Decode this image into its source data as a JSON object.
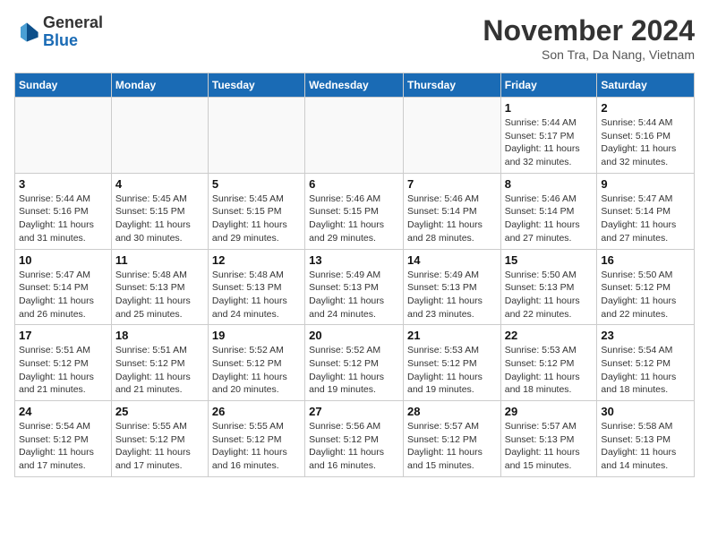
{
  "header": {
    "logo_general": "General",
    "logo_blue": "Blue",
    "month_year": "November 2024",
    "location": "Son Tra, Da Nang, Vietnam"
  },
  "days_of_week": [
    "Sunday",
    "Monday",
    "Tuesday",
    "Wednesday",
    "Thursday",
    "Friday",
    "Saturday"
  ],
  "weeks": [
    [
      {
        "day": "",
        "info": ""
      },
      {
        "day": "",
        "info": ""
      },
      {
        "day": "",
        "info": ""
      },
      {
        "day": "",
        "info": ""
      },
      {
        "day": "",
        "info": ""
      },
      {
        "day": "1",
        "info": "Sunrise: 5:44 AM\nSunset: 5:17 PM\nDaylight: 11 hours\nand 32 minutes."
      },
      {
        "day": "2",
        "info": "Sunrise: 5:44 AM\nSunset: 5:16 PM\nDaylight: 11 hours\nand 32 minutes."
      }
    ],
    [
      {
        "day": "3",
        "info": "Sunrise: 5:44 AM\nSunset: 5:16 PM\nDaylight: 11 hours\nand 31 minutes."
      },
      {
        "day": "4",
        "info": "Sunrise: 5:45 AM\nSunset: 5:15 PM\nDaylight: 11 hours\nand 30 minutes."
      },
      {
        "day": "5",
        "info": "Sunrise: 5:45 AM\nSunset: 5:15 PM\nDaylight: 11 hours\nand 29 minutes."
      },
      {
        "day": "6",
        "info": "Sunrise: 5:46 AM\nSunset: 5:15 PM\nDaylight: 11 hours\nand 29 minutes."
      },
      {
        "day": "7",
        "info": "Sunrise: 5:46 AM\nSunset: 5:14 PM\nDaylight: 11 hours\nand 28 minutes."
      },
      {
        "day": "8",
        "info": "Sunrise: 5:46 AM\nSunset: 5:14 PM\nDaylight: 11 hours\nand 27 minutes."
      },
      {
        "day": "9",
        "info": "Sunrise: 5:47 AM\nSunset: 5:14 PM\nDaylight: 11 hours\nand 27 minutes."
      }
    ],
    [
      {
        "day": "10",
        "info": "Sunrise: 5:47 AM\nSunset: 5:14 PM\nDaylight: 11 hours\nand 26 minutes."
      },
      {
        "day": "11",
        "info": "Sunrise: 5:48 AM\nSunset: 5:13 PM\nDaylight: 11 hours\nand 25 minutes."
      },
      {
        "day": "12",
        "info": "Sunrise: 5:48 AM\nSunset: 5:13 PM\nDaylight: 11 hours\nand 24 minutes."
      },
      {
        "day": "13",
        "info": "Sunrise: 5:49 AM\nSunset: 5:13 PM\nDaylight: 11 hours\nand 24 minutes."
      },
      {
        "day": "14",
        "info": "Sunrise: 5:49 AM\nSunset: 5:13 PM\nDaylight: 11 hours\nand 23 minutes."
      },
      {
        "day": "15",
        "info": "Sunrise: 5:50 AM\nSunset: 5:13 PM\nDaylight: 11 hours\nand 22 minutes."
      },
      {
        "day": "16",
        "info": "Sunrise: 5:50 AM\nSunset: 5:12 PM\nDaylight: 11 hours\nand 22 minutes."
      }
    ],
    [
      {
        "day": "17",
        "info": "Sunrise: 5:51 AM\nSunset: 5:12 PM\nDaylight: 11 hours\nand 21 minutes."
      },
      {
        "day": "18",
        "info": "Sunrise: 5:51 AM\nSunset: 5:12 PM\nDaylight: 11 hours\nand 21 minutes."
      },
      {
        "day": "19",
        "info": "Sunrise: 5:52 AM\nSunset: 5:12 PM\nDaylight: 11 hours\nand 20 minutes."
      },
      {
        "day": "20",
        "info": "Sunrise: 5:52 AM\nSunset: 5:12 PM\nDaylight: 11 hours\nand 19 minutes."
      },
      {
        "day": "21",
        "info": "Sunrise: 5:53 AM\nSunset: 5:12 PM\nDaylight: 11 hours\nand 19 minutes."
      },
      {
        "day": "22",
        "info": "Sunrise: 5:53 AM\nSunset: 5:12 PM\nDaylight: 11 hours\nand 18 minutes."
      },
      {
        "day": "23",
        "info": "Sunrise: 5:54 AM\nSunset: 5:12 PM\nDaylight: 11 hours\nand 18 minutes."
      }
    ],
    [
      {
        "day": "24",
        "info": "Sunrise: 5:54 AM\nSunset: 5:12 PM\nDaylight: 11 hours\nand 17 minutes."
      },
      {
        "day": "25",
        "info": "Sunrise: 5:55 AM\nSunset: 5:12 PM\nDaylight: 11 hours\nand 17 minutes."
      },
      {
        "day": "26",
        "info": "Sunrise: 5:55 AM\nSunset: 5:12 PM\nDaylight: 11 hours\nand 16 minutes."
      },
      {
        "day": "27",
        "info": "Sunrise: 5:56 AM\nSunset: 5:12 PM\nDaylight: 11 hours\nand 16 minutes."
      },
      {
        "day": "28",
        "info": "Sunrise: 5:57 AM\nSunset: 5:12 PM\nDaylight: 11 hours\nand 15 minutes."
      },
      {
        "day": "29",
        "info": "Sunrise: 5:57 AM\nSunset: 5:13 PM\nDaylight: 11 hours\nand 15 minutes."
      },
      {
        "day": "30",
        "info": "Sunrise: 5:58 AM\nSunset: 5:13 PM\nDaylight: 11 hours\nand 14 minutes."
      }
    ]
  ]
}
